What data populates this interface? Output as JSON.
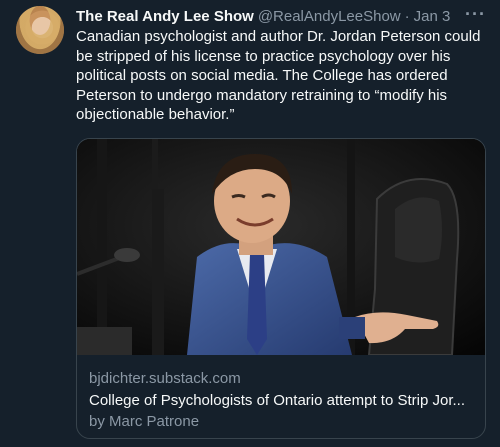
{
  "tweet": {
    "author_name": "The Real Andy Lee Show",
    "handle": "@RealAndyLeeShow",
    "separator": "·",
    "date": "Jan 3",
    "more_label": "···",
    "text": "Canadian psychologist and author Dr. Jordan Peterson could be stripped of his license to practice psychology over his political posts on social media. The College has ordered Peterson to undergo mandatory retraining to “modify his objectionable behavior.”"
  },
  "card": {
    "domain": "bjdichter.substack.com",
    "title": "College of Psychologists of Ontario attempt to Strip Jor...",
    "byline": "by Marc Patrone"
  },
  "colors": {
    "background": "#15202b",
    "text_primary": "#f7f9f9",
    "text_secondary": "#8b98a5",
    "border": "#38444d"
  }
}
